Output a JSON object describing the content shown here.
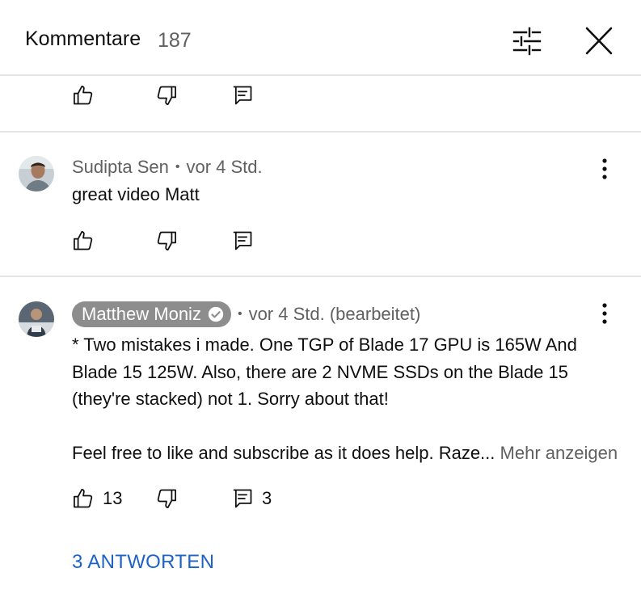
{
  "header": {
    "title": "Kommentare",
    "count": "187",
    "filter_icon": "tune-icon",
    "close_icon": "close-icon"
  },
  "comments": [
    {
      "author": "Sudipta Sen",
      "time": "vor 4 Std.",
      "text": "great video Matt",
      "likes": "",
      "replies": ""
    },
    {
      "author": "Matthew Moniz",
      "verified": true,
      "time": "vor 4 Std. (bearbeitet)",
      "text_lines": [
        "* Two mistakes i made. One TGP of Blade 17 GPU is 165W And",
        "Blade 15 125W. Also, there are 2 NVME SSDs on the Blade 15",
        "(they're stacked) not 1. Sorry about that!",
        "",
        "Feel free to like and subscribe as it does help. Raze..."
      ],
      "more_label": "Mehr anzeigen",
      "likes": "13",
      "replies": "3",
      "replies_link": "3 ANTWORTEN"
    }
  ],
  "colors": {
    "text": "#0f0f0f",
    "secondary": "#606060",
    "link": "#1c62c9",
    "divider": "#e5e5e5",
    "chip": "#8d8d8d"
  }
}
